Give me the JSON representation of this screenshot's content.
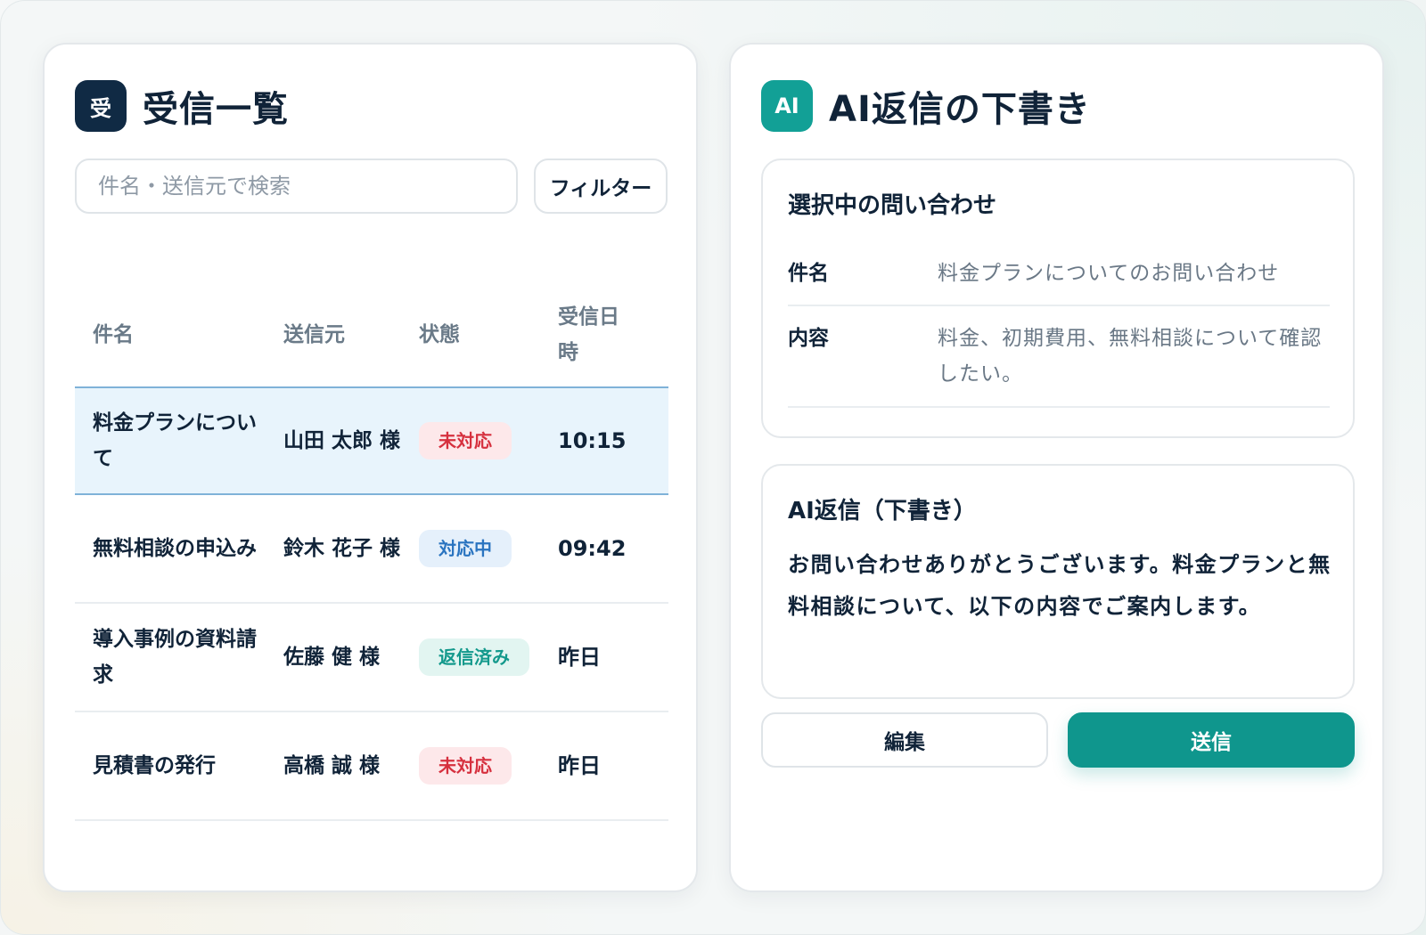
{
  "inbox": {
    "icon_text": "受",
    "title": "受信一覧",
    "search_placeholder": "件名・送信元で検索",
    "filter_label": "フィルター",
    "columns": {
      "subject": "件名",
      "sender": "送信元",
      "status": "状態",
      "received": "受信日時"
    },
    "rows": [
      {
        "subject": "料金プランについて",
        "sender": "山田 太郎 様",
        "status": "未対応",
        "status_color": "#d6303e",
        "time": "10:15",
        "selected": true
      },
      {
        "subject": "無料相談の申込み",
        "sender": "鈴木 花子 様",
        "status": "対応中",
        "status_color": "#2a74c0",
        "time": "09:42",
        "selected": false
      },
      {
        "subject": "導入事例の資料請求",
        "sender": "佐藤 健 様",
        "status": "返信済み",
        "status_color": "#13998c",
        "time": "昨日",
        "selected": false
      },
      {
        "subject": "見積書の発行",
        "sender": "高橋 誠 様",
        "status": "未対応",
        "status_color": "#d6303e",
        "time": "昨日",
        "selected": false
      }
    ]
  },
  "draft": {
    "icon_text": "AI",
    "title": "AI返信の下書き",
    "inquiry": {
      "title": "選択中の問い合わせ",
      "subject_label": "件名",
      "subject_value": "料金プランについてのお問い合わせ",
      "content_label": "内容",
      "content_value": "料金、初期費用、無料相談について確認したい。"
    },
    "reply": {
      "title": "AI返信（下書き）",
      "body": "お問い合わせありがとうございます。料金プランと無料相談について、以下の内容でご案内します。"
    },
    "edit_label": "編集",
    "send_label": "送信"
  },
  "colors": {
    "navy": "#102a44",
    "teal": "#12a096",
    "send_button": "#0f968d",
    "selected_row": "#e8f4fc"
  }
}
